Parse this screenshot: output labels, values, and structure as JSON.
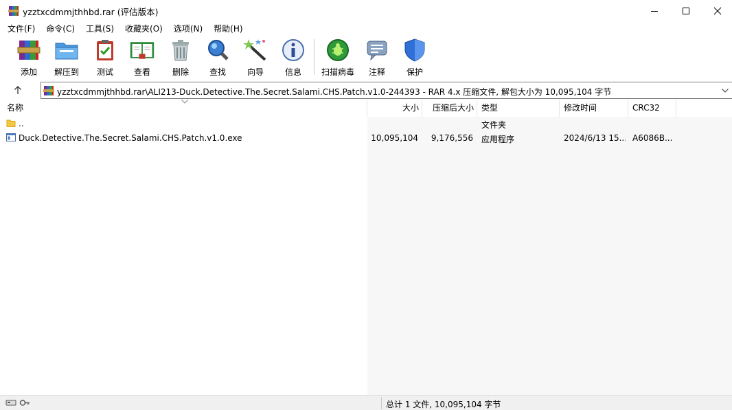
{
  "window": {
    "title": "yzztxcdmmjthhbd.rar (评估版本)"
  },
  "menu": [
    "文件(F)",
    "命令(C)",
    "工具(S)",
    "收藏夹(O)",
    "选项(N)",
    "帮助(H)"
  ],
  "toolbar": {
    "add": "添加",
    "extract": "解压到",
    "test": "测试",
    "view": "查看",
    "delete": "删除",
    "find": "查找",
    "wizard": "向导",
    "info": "信息",
    "scan": "扫描病毒",
    "comment": "注释",
    "protect": "保护"
  },
  "address": {
    "path": "yzztxcdmmjthhbd.rar\\ALI213-Duck.Detective.The.Secret.Salami.CHS.Patch.v1.0-244393 - RAR 4.x 压缩文件, 解包大小为 10,095,104 字节"
  },
  "columns": {
    "name": "名称",
    "size": "大小",
    "packed": "压缩后大小",
    "type": "类型",
    "modified": "修改时间",
    "crc": "CRC32"
  },
  "rows": [
    {
      "name": "..",
      "size": "",
      "packed": "",
      "type": "文件夹",
      "modified": "",
      "crc": ""
    },
    {
      "name": "Duck.Detective.The.Secret.Salami.CHS.Patch.v1.0.exe",
      "size": "10,095,104",
      "packed": "9,176,556",
      "type": "应用程序",
      "modified": "2024/6/13 15...",
      "crc": "A6086B..."
    }
  ],
  "status": {
    "summary": "总计 1 文件, 10,095,104 字节"
  }
}
